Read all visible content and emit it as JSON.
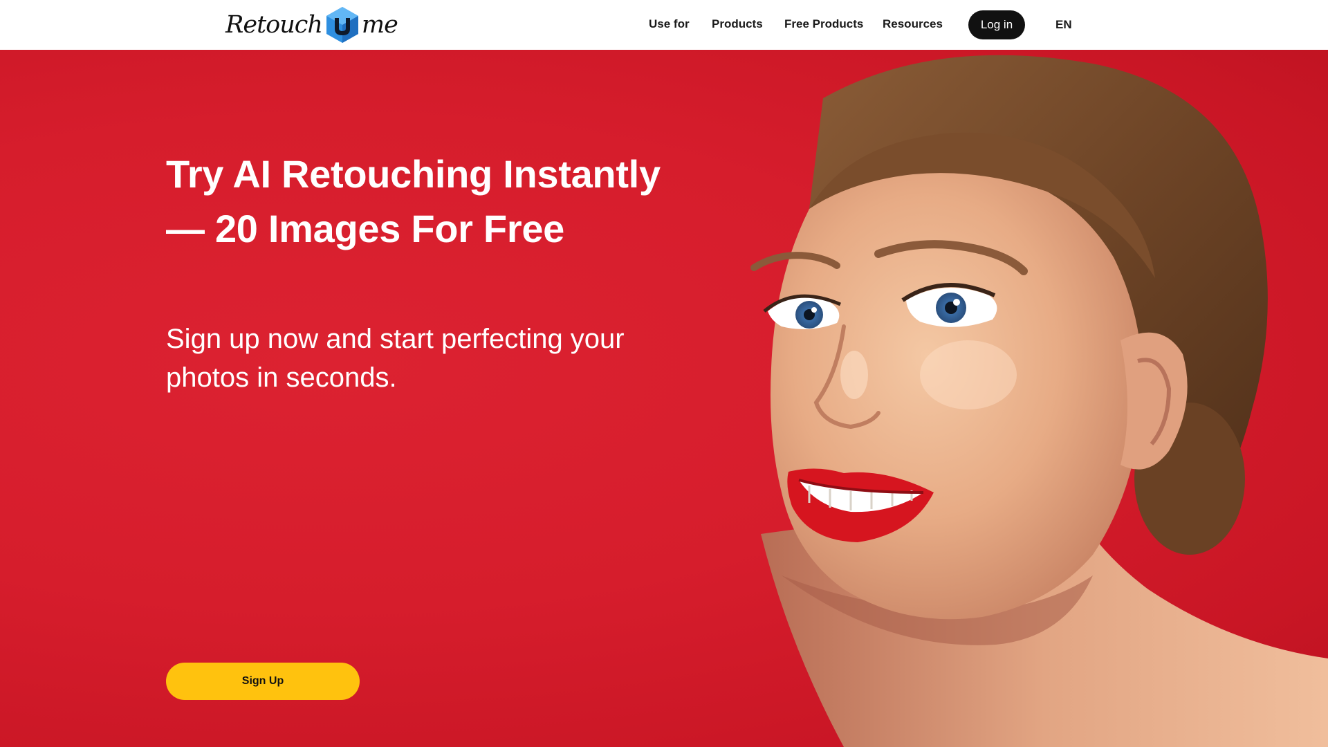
{
  "header": {
    "logo": {
      "left_word": "Retouch",
      "right_word": "me",
      "mark_icon": "hexagon-u-logo-icon"
    },
    "nav": [
      {
        "label": "Use for"
      },
      {
        "label": "Products"
      },
      {
        "label": "Free Products"
      },
      {
        "label": "Resources"
      }
    ],
    "login_label": "Log in",
    "language": "EN"
  },
  "hero": {
    "title": "Try AI Retouching Instantly — 20 Images For Free",
    "subtitle": "Sign up now and start perfecting your photos in seconds.",
    "signup_label": "Sign Up",
    "image": "smiling-woman-portrait-red-lipstick"
  },
  "colors": {
    "hero_background": "#d61d2c",
    "cta_yellow": "#ffc20e",
    "login_black": "#111111",
    "logo_blue": "#2e8fe0"
  }
}
